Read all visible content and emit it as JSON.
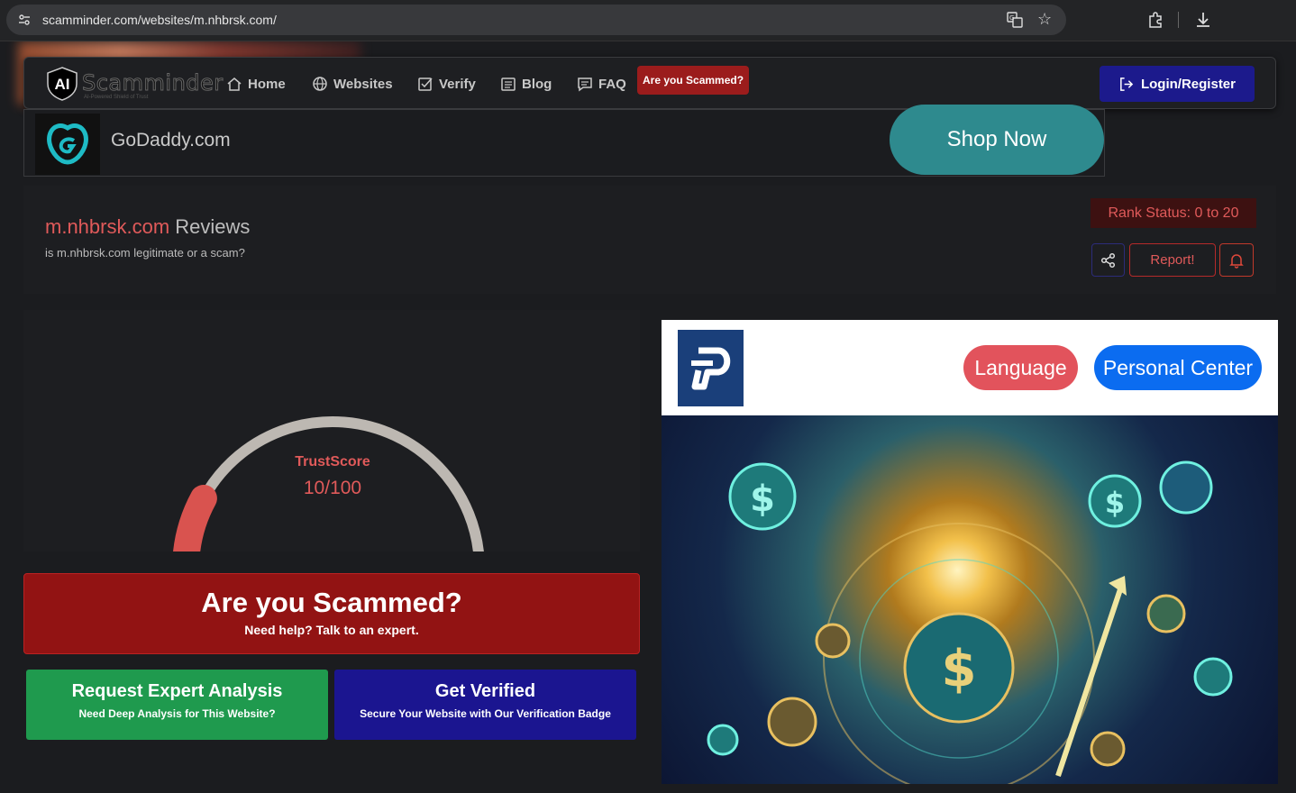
{
  "browser": {
    "url": "scamminder.com/websites/m.nhbrsk.com/"
  },
  "navbar": {
    "logo_brand": "Scamminder",
    "logo_ai": "AI",
    "logo_tagline": "AI-Powered Shield of Trust",
    "items": [
      {
        "label": "Home",
        "icon": "home-icon"
      },
      {
        "label": "Websites",
        "icon": "globe-icon"
      },
      {
        "label": "Verify",
        "icon": "check-square-icon"
      },
      {
        "label": "Blog",
        "icon": "document-icon"
      },
      {
        "label": "FAQ",
        "icon": "chat-icon"
      }
    ],
    "scammed_label": "Are you Scammed?",
    "login_label": "Login/Register"
  },
  "ad_banner": {
    "name": "GoDaddy.com",
    "cta": "Shop Now"
  },
  "site_header": {
    "domain": "m.nhbrsk.com",
    "title_suffix": " Reviews",
    "subtitle": "is m.nhbrsk.com legitimate or a scam?",
    "rank_status": "Rank Status: 0 to 20",
    "report_label": "Report!"
  },
  "trust": {
    "label": "TrustScore",
    "value_text": "10/100",
    "score": 10,
    "max": 100
  },
  "scammed_box": {
    "title": "Are you Scammed?",
    "subtitle": "Need help? Talk to an expert."
  },
  "expert_box": {
    "title": "Request Expert Analysis",
    "subtitle": "Need Deep Analysis for This Website?"
  },
  "verify_box": {
    "title": "Get Verified",
    "subtitle": "Secure Your Website with Our Verification Badge"
  },
  "right_ad": {
    "language_label": "Language",
    "personal_center_label": "Personal Center"
  },
  "colors": {
    "accent_red": "#e05a5a",
    "scammed_red": "#921313",
    "login_blue": "#1c1a8c",
    "expert_green": "#1f9a4e",
    "verify_blue": "#1b1590"
  }
}
